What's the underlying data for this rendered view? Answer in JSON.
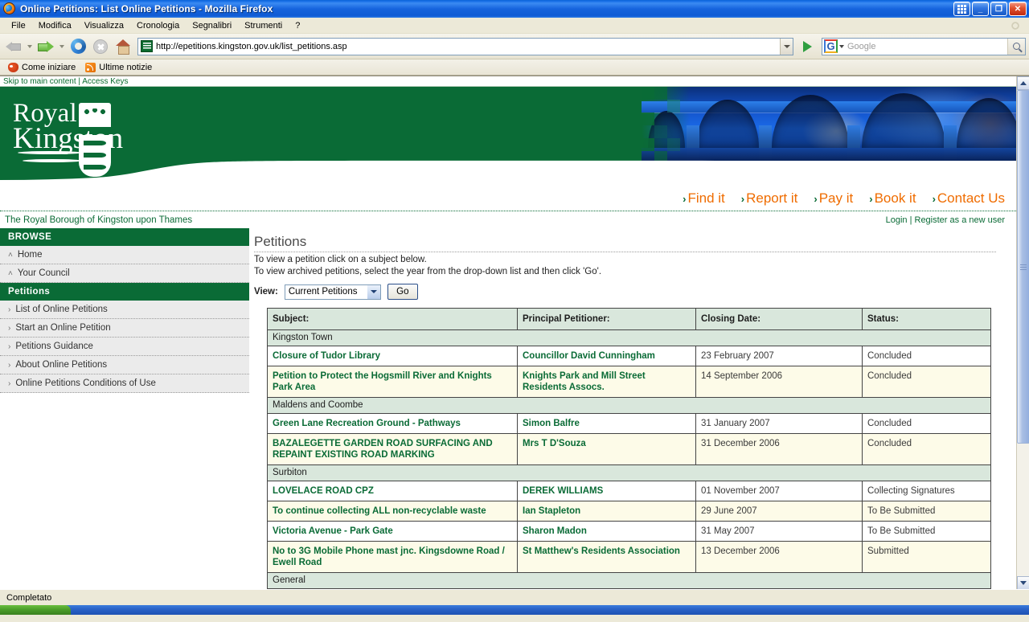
{
  "window": {
    "title": "Online Petitions: List Online Petitions - Mozilla Firefox",
    "minimize_label": "_",
    "restore_label": "❐",
    "close_label": "✕"
  },
  "menubar": {
    "items": [
      "File",
      "Modifica",
      "Visualizza",
      "Cronologia",
      "Segnalibri",
      "Strumenti",
      "?"
    ]
  },
  "toolbar": {
    "url": "http://epetitions.kingston.gov.uk/list_petitions.asp",
    "search_placeholder": "Google",
    "search_engine": "G"
  },
  "bookmarks": {
    "items": [
      "Come iniziare",
      "Ultime notizie"
    ]
  },
  "page": {
    "skip_links": "Skip to main content | Access Keys",
    "logo": {
      "line1": "Royal",
      "line2": "Kingston"
    },
    "quicklinks": [
      {
        "chevron": "›",
        "label": "Find it"
      },
      {
        "chevron": "›",
        "label": "Report it"
      },
      {
        "chevron": "›",
        "label": "Pay it"
      },
      {
        "chevron": "›",
        "label": "Book it"
      },
      {
        "chevron": "›",
        "label": "Contact Us"
      }
    ],
    "brand_line": "The Royal Borough of Kingston upon Thames",
    "account": {
      "login": "Login",
      "separator": "|",
      "register": "Register as a new user"
    },
    "sidebar": {
      "browse_heading": "BROWSE",
      "browse_items": [
        {
          "caret": "˄",
          "label": "Home"
        },
        {
          "caret": "˄",
          "label": "Your Council"
        }
      ],
      "petitions_heading": "Petitions",
      "petitions_items": [
        {
          "caret": "›",
          "label": "List of Online Petitions"
        },
        {
          "caret": "›",
          "label": "Start an Online Petition"
        },
        {
          "caret": "›",
          "label": "Petitions Guidance"
        },
        {
          "caret": "›",
          "label": "About Online Petitions"
        },
        {
          "caret": "›",
          "label": "Online Petitions Conditions of Use"
        }
      ]
    },
    "main": {
      "title": "Petitions",
      "intro_line1": "To view a petition click on a subject below.",
      "intro_line2": "To view archived petitions, select the year from the drop-down list and then click 'Go'.",
      "view_label": "View:",
      "view_selected": "Current Petitions",
      "go_label": "Go",
      "table": {
        "headers": [
          "Subject:",
          "Principal Petitioner:",
          "Closing Date:",
          "Status:"
        ],
        "groups": [
          {
            "name": "Kingston Town",
            "rows": [
              {
                "subject": "Closure of Tudor Library",
                "petitioner": "Councillor David Cunningham",
                "closing_date": "23 February 2007",
                "status": "Concluded"
              },
              {
                "subject": "Petition to Protect the Hogsmill River and Knights Park Area",
                "petitioner": "Knights Park and Mill Street Residents Assocs.",
                "closing_date": "14 September 2006",
                "status": "Concluded"
              }
            ]
          },
          {
            "name": "Maldens and Coombe",
            "rows": [
              {
                "subject": "Green Lane Recreation Ground - Pathways",
                "petitioner": "Simon Balfre",
                "closing_date": "31 January 2007",
                "status": "Concluded"
              },
              {
                "subject": "BAZALEGETTE GARDEN ROAD SURFACING AND REPAINT EXISTING ROAD MARKING",
                "petitioner": "Mrs T D'Souza",
                "closing_date": "31 December 2006",
                "status": "Concluded"
              }
            ]
          },
          {
            "name": "Surbiton",
            "rows": [
              {
                "subject": "LOVELACE ROAD CPZ",
                "petitioner": "DEREK WILLIAMS",
                "closing_date": "01 November 2007",
                "status": "Collecting Signatures"
              },
              {
                "subject": "To continue collecting ALL non-recyclable waste",
                "petitioner": "Ian Stapleton",
                "closing_date": "29 June 2007",
                "status": "To Be Submitted"
              },
              {
                "subject": "Victoria Avenue - Park Gate",
                "petitioner": "Sharon Madon",
                "closing_date": "31 May 2007",
                "status": "To Be Submitted"
              },
              {
                "subject": "No to 3G Mobile Phone mast jnc. Kingsdowne Road / Ewell Road",
                "petitioner": "St Matthew's Residents Association",
                "closing_date": "13 December 2006",
                "status": "Submitted"
              }
            ]
          },
          {
            "name": "General",
            "rows": []
          }
        ]
      }
    }
  },
  "statusbar": {
    "text": "Completato"
  },
  "colors": {
    "brand_green": "#0a6b36",
    "accent_orange": "#ef6c00",
    "table_header_bg": "#d9e7dc",
    "alt_row_bg": "#fdfbe8",
    "titlebar_blue": "#1b72e8"
  }
}
